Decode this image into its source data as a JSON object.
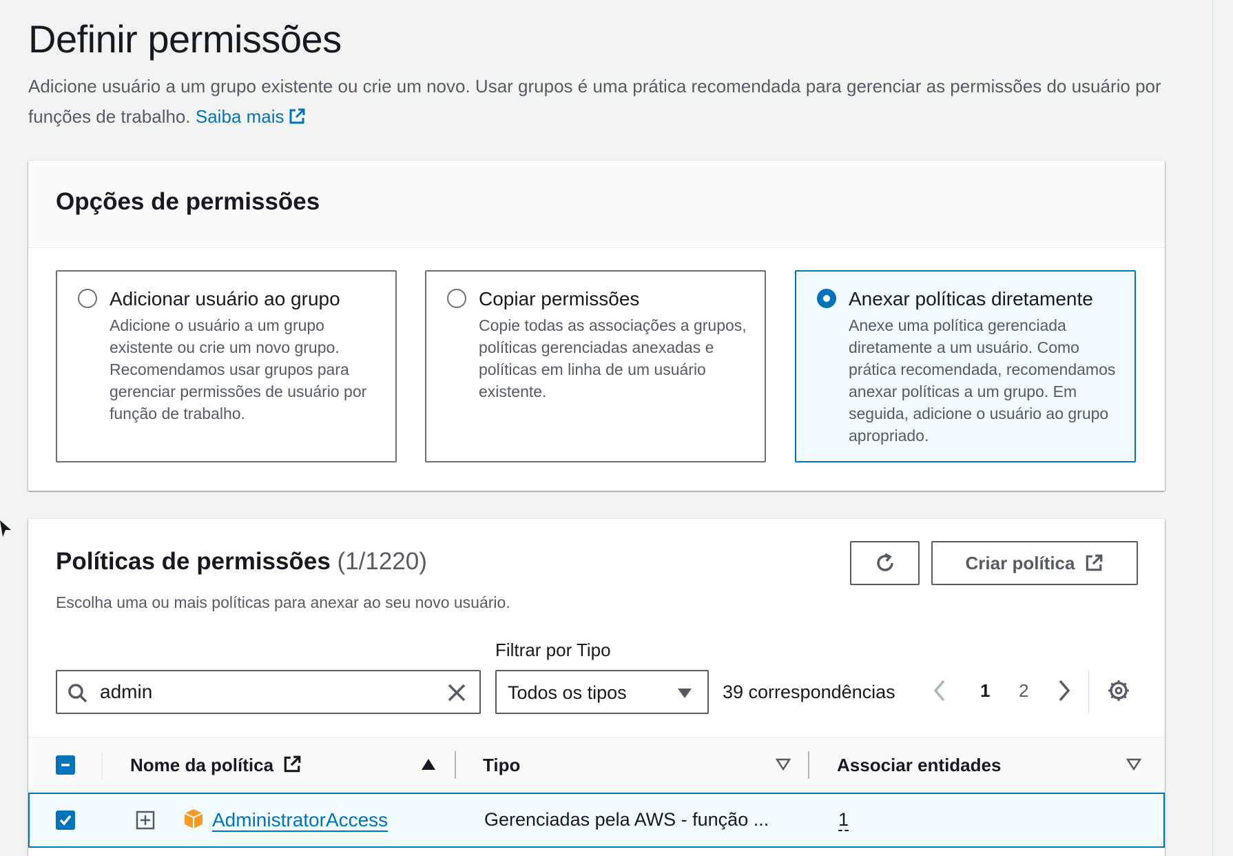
{
  "header": {
    "title": "Definir permissões",
    "description": "Adicione usuário a um grupo existente ou crie um novo. Usar grupos é uma prática recomendada para gerenciar as permissões do usuário por funções de trabalho.",
    "learn_more": "Saiba mais"
  },
  "options": {
    "title": "Opções de permissões",
    "tiles": [
      {
        "title": "Adicionar usuário ao grupo",
        "description": "Adicione o usuário a um grupo existente ou crie um novo grupo. Recomendamos usar grupos para gerenciar permissões de usuário por função de trabalho.",
        "selected": false
      },
      {
        "title": "Copiar permissões",
        "description": "Copie todas as associações a grupos, políticas gerenciadas anexadas e políticas em linha de um usuário existente.",
        "selected": false
      },
      {
        "title": "Anexar políticas diretamente",
        "description": "Anexe uma política gerenciada diretamente a um usuário. Como prática recomendada, recomendamos anexar políticas a um grupo. Em seguida, adicione o usuário ao grupo apropriado.",
        "selected": true
      }
    ]
  },
  "policies": {
    "title": "Políticas de permissões",
    "count": "(1/1220)",
    "subtitle": "Escolha uma ou mais políticas para anexar ao seu novo usuário.",
    "create_button": "Criar política",
    "refresh_icon": "refresh-icon",
    "filter_label": "Filtrar por Tipo",
    "search_value": "admin",
    "type_filter_value": "Todos os tipos",
    "matches": "39 correspondências",
    "pages": [
      "1",
      "2"
    ],
    "current_page": "1",
    "columns": {
      "name": "Nome da política",
      "type": "Tipo",
      "entities": "Associar entidades"
    },
    "rows": [
      {
        "name": "AdministratorAccess",
        "type": "Gerenciadas pela AWS - função ...",
        "entities": "1",
        "checked": true
      }
    ]
  },
  "colors": {
    "accent": "#0073bb",
    "selected_bg": "#f1faff",
    "policy_icon": "#f59a23"
  }
}
